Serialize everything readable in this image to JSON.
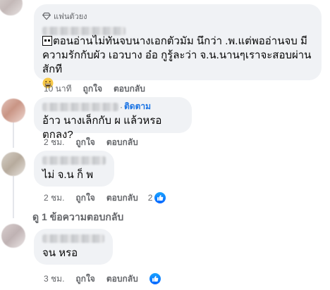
{
  "comments": [
    {
      "fan_label": "แฟนตัวยง",
      "text": "ตอนอ่านไม่ทันจบนางเอกตัวมัม นึกว่า .พ.แต่พออ่านจบ มี ความรักกับผัว เอวบาง อ๋อ กูรู้ละว่า จ.น.นานๆเราจะสอบผ่านสักที",
      "time": "10 นาที",
      "like_label": "ถูกใจ",
      "reply_label": "ตอบกลับ"
    },
    {
      "follow_label": "ติดตาม",
      "text": "อ้าว นางเล็กกับ ผ แล้วหรอตกลง?",
      "time": "2 ชม.",
      "like_label": "ถูกใจ",
      "reply_label": "ตอบกลับ"
    },
    {
      "text": "ไม่ จ.น ก็ พ",
      "time": "2 ชม.",
      "like_label": "ถูกใจ",
      "reply_label": "ตอบกลับ",
      "reaction_count": "2"
    },
    {
      "text": "จน หรอ",
      "time": "3 ชม.",
      "like_label": "ถูกใจ",
      "reply_label": "ตอบกลับ"
    }
  ],
  "view_replies": "ดู 1 ข้อความตอบกลับ",
  "colors": {
    "bubble": "#f0f2f5",
    "meta": "#65676b",
    "link": "#1b74e4",
    "like": "#0866ff"
  }
}
